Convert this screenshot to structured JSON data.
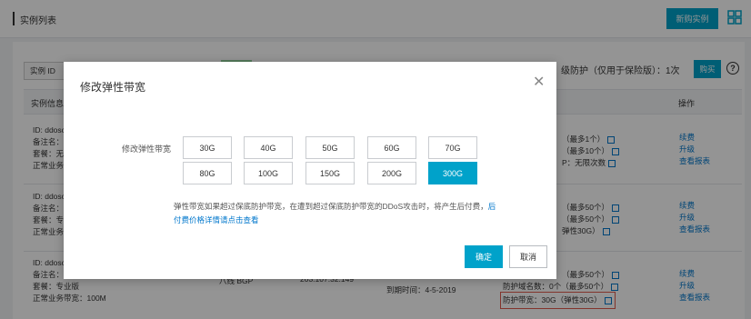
{
  "header": {
    "title": "实例列表",
    "new_button": "新购实例"
  },
  "filter": {
    "select_label": "实例 ID",
    "protection_text": "级防护（仅用于保险版）：1次",
    "buy_button": "购买"
  },
  "table": {
    "col_info": "实例信息",
    "col_action": "操作",
    "rows": [
      {
        "left": [
          "ID: ddosc",
          "备注名：",
          "套餐：无",
          "正常业务带"
        ],
        "right": [
          "（最多1个）",
          "（最多10个）",
          "P：无限次数"
        ],
        "actions": [
          "续费",
          "升级",
          "查看报表"
        ]
      },
      {
        "left": [
          "ID: ddosc",
          "备注名：",
          "套餐：专",
          "正常业务带"
        ],
        "right": [
          "（最多50个）",
          "（最多50个）",
          "弹性30G）"
        ],
        "actions": [
          "续费",
          "升级",
          "查看报表"
        ]
      },
      {
        "left": [
          "ID: ddosc",
          "备注名：",
          "套餐：专业版",
          "正常业务带宽：100M"
        ],
        "line_label": "八线 BGP",
        "ip": "203.107.32.149",
        "expire": "到期时间：4-5-2019",
        "right": [
          "（最多50个）",
          "防护域名数：0个（最多50个）",
          "防护带宽：30G（弹性30G）"
        ],
        "actions": [
          "续费",
          "升级",
          "查看报表"
        ]
      }
    ]
  },
  "modal": {
    "title": "修改弹性带宽",
    "field_label": "修改弹性带宽",
    "options": [
      "30G",
      "40G",
      "50G",
      "60G",
      "70G",
      "80G",
      "100G",
      "150G",
      "200G",
      "300G"
    ],
    "selected": "300G",
    "note_text": "弹性带宽如果超过保底防护带宽，在遭到超过保底防护带宽的DDoS攻击时，将产生后付费，",
    "note_link_1": "后",
    "note_link_2": "付费价格详情请点击查看",
    "confirm": "确定",
    "cancel": "取消"
  },
  "colors": {
    "accent": "#00a2ca",
    "highlight_border": "#e05a4c",
    "link": "#0077cc"
  }
}
